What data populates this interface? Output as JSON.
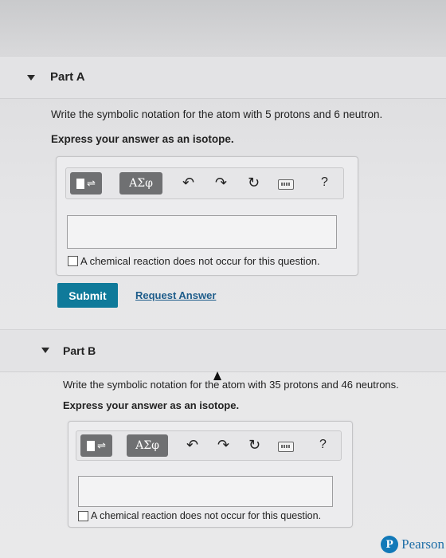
{
  "part_a": {
    "title": "Part A",
    "question": "Write the symbolic notation for the atom with 5 protons and 6 neutron.",
    "instruction": "Express your answer as an isotope.",
    "toolbar": {
      "greek_label": "ΑΣφ",
      "help_label": "?"
    },
    "input_value": "",
    "checkbox_label": "A chemical reaction does not occur for this question.",
    "submit_label": "Submit",
    "request_label": "Request Answer"
  },
  "part_b": {
    "title": "Part B",
    "question": "Write the symbolic notation for the atom with 35 protons and 46 neutrons.",
    "instruction": "Express your answer as an isotope.",
    "toolbar": {
      "greek_label": "ΑΣφ",
      "help_label": "?"
    },
    "input_value": "",
    "checkbox_label": "A chemical reaction does not occur for this question."
  },
  "brand": {
    "name": "Pearson",
    "logo_letter": "P",
    "color": "#1179b8"
  },
  "colors": {
    "submit": "#0f7a9a",
    "link": "#1d5c8a"
  }
}
